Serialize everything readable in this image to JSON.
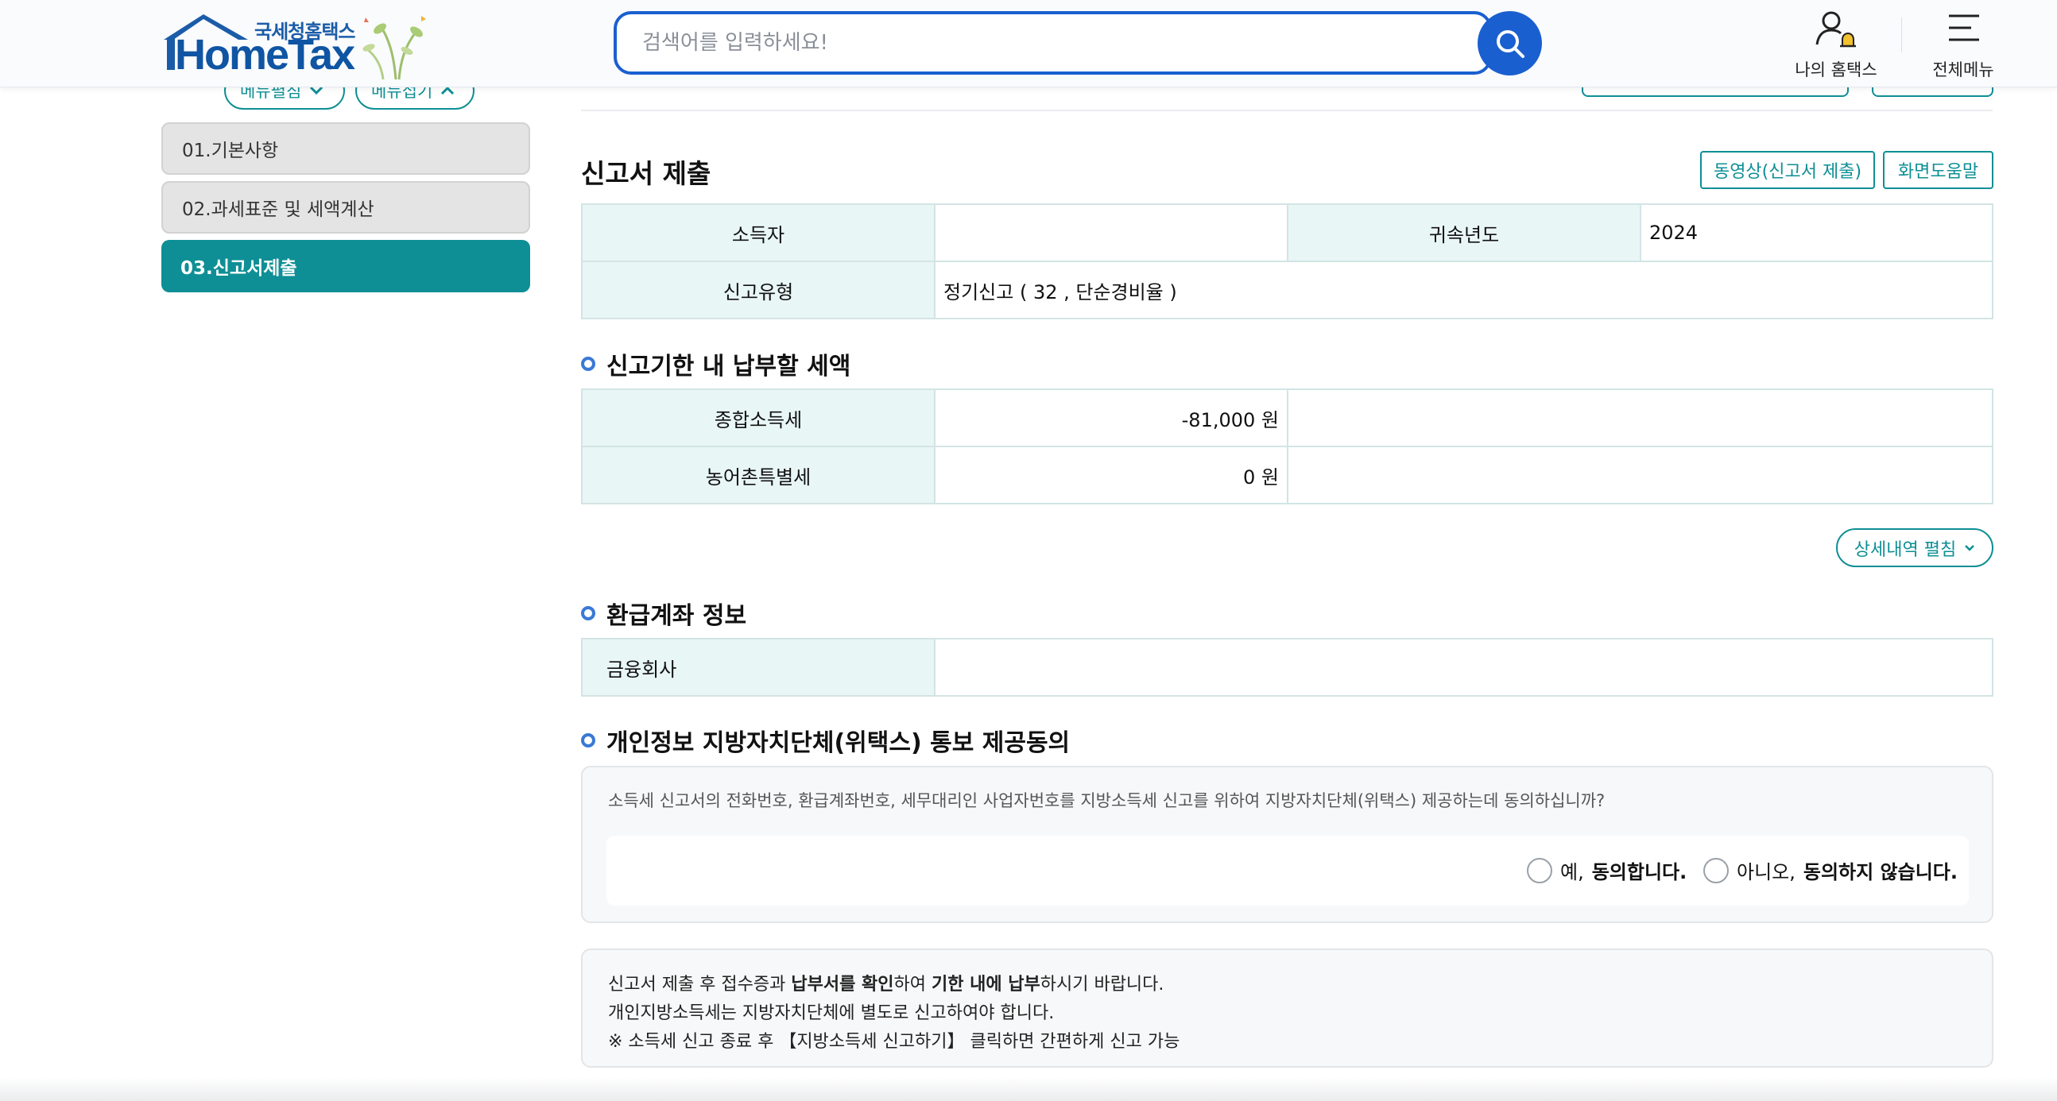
{
  "header": {
    "logo_subtitle": "국세청홈택스",
    "logo_title": "HomeTax",
    "search_placeholder": "검색어를 입력하세요!",
    "my_hometax_label": "나의 홈택스",
    "all_menu_label": "전체메뉴",
    "brand_color": "#1a5fd0"
  },
  "sidebar": {
    "expand_label": "메뉴펼침",
    "collapse_label": "메뉴접기",
    "items": [
      {
        "label": "01.기본사항",
        "active": false
      },
      {
        "label": "02.과세표준 및 세액계산",
        "active": false
      },
      {
        "label": "03.신고서제출",
        "active": true
      }
    ],
    "accent_color": "#0e8f95"
  },
  "main": {
    "title": "신고서 제출",
    "video_button": "동영상(신고서 제출)",
    "help_button": "화면도움말",
    "info": {
      "income_earner_label": "소득자",
      "income_earner_value": "",
      "tax_year_label": "귀속년도",
      "tax_year_value": "2024",
      "report_type_label": "신고유형",
      "report_type_value": "정기신고 ( 32 , 단순경비율 )"
    },
    "payment_section": {
      "title": "신고기한 내 납부할 세액",
      "rows": [
        {
          "label": "종합소득세",
          "value": "-81,000 원"
        },
        {
          "label": "농어촌특별세",
          "value": "0 원"
        }
      ],
      "detail_button": "상세내역 펼침"
    },
    "refund_section": {
      "title": "환급계좌 정보",
      "financial_company_label": "금융회사",
      "financial_company_value": ""
    },
    "consent_section": {
      "title": "개인정보 지방자치단체(위택스) 통보 제공동의",
      "question": "소득세 신고서의 전화번호, 환급계좌번호, 세무대리인 사업자번호를 지방소득세 신고를 위하여 지방자치단체(위택스) 제공하는데 동의하십니까?",
      "yes_prefix": "예,",
      "yes_bold": "동의합니다.",
      "no_prefix": "아니오,",
      "no_bold": "동의하지 않습니다."
    },
    "notice": {
      "line1_a": "신고서 제출 후 접수증과 ",
      "line1_b": "납부서를 확인",
      "line1_c": "하여 ",
      "line1_d": "기한 내에 납부",
      "line1_e": "하시기 바랍니다.",
      "line2": "개인지방소득세는 지방자치단체에 별도로 신고하여야 합니다.",
      "line3": "※ 소득세 신고 종료 후 【지방소득세 신고하기】 클릭하면 간편하게 신고 가능"
    }
  }
}
